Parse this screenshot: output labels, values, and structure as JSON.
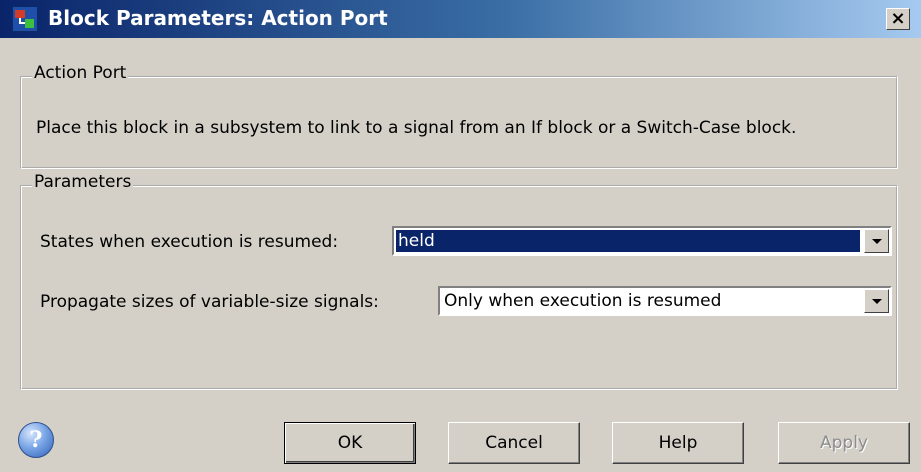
{
  "window": {
    "title": "Block Parameters: Action Port",
    "close_label": "×"
  },
  "action_port": {
    "legend": "Action Port",
    "description": "Place this block in a subsystem to link to a signal from an If block or a Switch-Case block."
  },
  "parameters": {
    "legend": "Parameters",
    "states_label": "States when execution is resumed:",
    "states_value": "held",
    "propagate_label": "Propagate sizes of variable-size signals:",
    "propagate_value": "Only when execution is resumed"
  },
  "buttons": {
    "ok": "OK",
    "cancel": "Cancel",
    "help": "Help",
    "apply": "Apply"
  },
  "icons": {
    "window": "simulink-block-icon",
    "help": "help-icon"
  },
  "colors": {
    "titlebar_start": "#0a246a",
    "titlebar_end": "#a6caf0",
    "selection": "#0a246a",
    "face": "#d4d0c8"
  }
}
